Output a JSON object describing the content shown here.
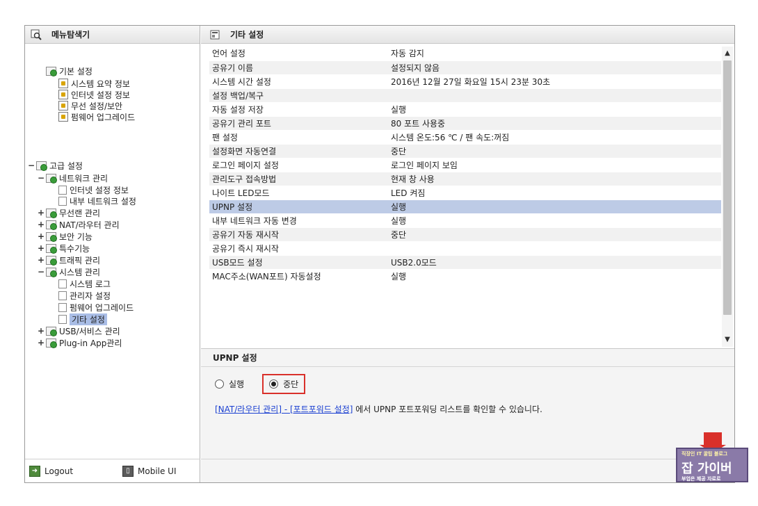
{
  "left_panel": {
    "title": "메뉴탐색기",
    "tree": [
      {
        "label": "기본 설정",
        "prefix": "",
        "icon": "folder"
      },
      {
        "label": "시스템 요약 정보",
        "prefix": "",
        "icon": "gear"
      },
      {
        "label": "인터넷 설정 정보",
        "prefix": "",
        "icon": "gear"
      },
      {
        "label": "무선 설정/보안",
        "prefix": "",
        "icon": "gear"
      },
      {
        "label": "펌웨어 업그레이드",
        "prefix": "",
        "icon": "gear"
      },
      {
        "label": "고급 설정",
        "prefix": "-",
        "icon": "folder"
      },
      {
        "label": "네트워크 관리",
        "prefix": "-",
        "icon": "folder"
      },
      {
        "label": "인터넷 설정 정보",
        "prefix": "",
        "icon": "page"
      },
      {
        "label": "내부 네트워크 설정",
        "prefix": "",
        "icon": "page"
      },
      {
        "label": "무선랜 관리",
        "prefix": "+",
        "icon": "folder"
      },
      {
        "label": "NAT/라우터 관리",
        "prefix": "+",
        "icon": "folder"
      },
      {
        "label": "보안 기능",
        "prefix": "+",
        "icon": "folder"
      },
      {
        "label": "특수기능",
        "prefix": "+",
        "icon": "folder"
      },
      {
        "label": "트래픽 관리",
        "prefix": "+",
        "icon": "folder"
      },
      {
        "label": "시스템 관리",
        "prefix": "-",
        "icon": "folder"
      },
      {
        "label": "시스템 로그",
        "prefix": "",
        "icon": "page"
      },
      {
        "label": "관리자 설정",
        "prefix": "",
        "icon": "page"
      },
      {
        "label": "펌웨어 업그레이드",
        "prefix": "",
        "icon": "page"
      },
      {
        "label": "기타 설정",
        "prefix": "",
        "icon": "page"
      },
      {
        "label": "USB/서비스 관리",
        "prefix": "+",
        "icon": "folder"
      },
      {
        "label": "Plug-in App관리",
        "prefix": "+",
        "icon": "folder"
      }
    ],
    "selected_index": 18,
    "footer": {
      "logout_label": "Logout",
      "mobile_label": "Mobile UI"
    }
  },
  "right_panel": {
    "title": "기타 설정",
    "rows": [
      {
        "key": "언어 설정",
        "value": "자동 감지"
      },
      {
        "key": "공유기 이름",
        "value": "설정되지 않음"
      },
      {
        "key": "시스템 시간 설정",
        "value": "2016년 12월 27일 화요일 15시 23분 30초"
      },
      {
        "key": "설정 백업/복구",
        "value": ""
      },
      {
        "key": "자동 설정 저장",
        "value": "실행"
      },
      {
        "key": "공유기 관리 포트",
        "value": "80 포트 사용중"
      },
      {
        "key": "팬 설정",
        "value": "시스템 온도:56 ℃ / 팬 속도:꺼짐"
      },
      {
        "key": "설정화면 자동연결",
        "value": "중단"
      },
      {
        "key": "로그인 페이지 설정",
        "value": "로그인 페이지 보임"
      },
      {
        "key": "관리도구 접속방법",
        "value": "현재 창 사용"
      },
      {
        "key": "나이트 LED모드",
        "value": "LED 켜짐"
      },
      {
        "key": "UPNP 설정",
        "value": "실행"
      },
      {
        "key": "내부 네트워크 자동 변경",
        "value": "실행"
      },
      {
        "key": "공유기 자동 재시작",
        "value": "중단"
      },
      {
        "key": "공유기 즉시 재시작",
        "value": ""
      },
      {
        "key": "USB모드 설정",
        "value": "USB2.0모드"
      },
      {
        "key": "MAC주소(WAN포트) 자동설정",
        "value": "실행"
      }
    ],
    "highlighted_index": 11,
    "detail": {
      "title": "UPNP 설정",
      "option_run": "실행",
      "option_stop": "중단",
      "selected": "stop",
      "link_text": "[NAT/라우터 관리] - [포트포워드 설정]",
      "link_suffix": " 에서 UPNP 포트포워딩 리스트를 확인할 수 있습니다."
    }
  },
  "watermark": {
    "top_text": "직장인 IT 꿀팁 블로그",
    "main_text": "잡 가이버",
    "bottom_text": "부업은 제공 자료로",
    "color": "#8a7aa8",
    "arrow_color": "#d9302a"
  }
}
